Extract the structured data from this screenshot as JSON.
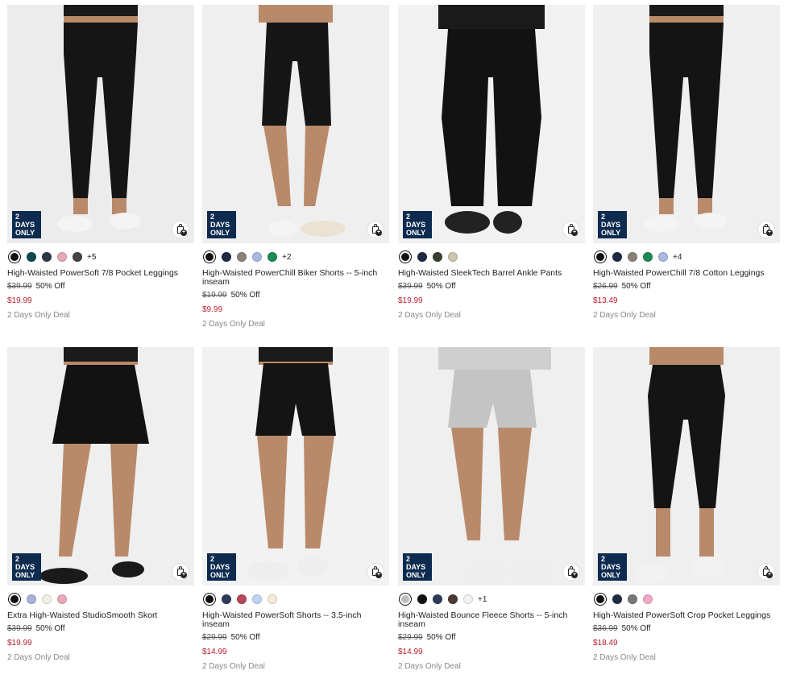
{
  "products": [
    {
      "name": "High-Waisted PowerSoft 7/8 Pocket Leggings",
      "original_price": "$39.99",
      "discount": "50% Off",
      "sale_price": "$19.99",
      "deal": "2 Days Only Deal",
      "badge": "2 DAYS ONLY",
      "swatches": [
        "#111111",
        "#0e4a4e",
        "#2d3748",
        "#e8a9b6",
        "#444444"
      ],
      "more": "+5",
      "garment": "leggings",
      "garment_color": "#151515",
      "bg": "#ececec"
    },
    {
      "name": "High-Waisted PowerChill Biker Shorts -- 5-inch inseam",
      "original_price": "$19.99",
      "discount": "50% Off",
      "sale_price": "$9.99",
      "deal": "2 Days Only Deal",
      "badge": "2 DAYS ONLY",
      "swatches": [
        "#111111",
        "#1f2a44",
        "#8a8279",
        "#a9b8e0",
        "#1c8a55"
      ],
      "more": "+2",
      "garment": "biker",
      "garment_color": "#161616",
      "bg": "#efefef"
    },
    {
      "name": "High-Waisted SleekTech Barrel Ankle Pants",
      "original_price": "$39.99",
      "discount": "50% Off",
      "sale_price": "$19.99",
      "deal": "2 Days Only Deal",
      "badge": "2 DAYS ONLY",
      "swatches": [
        "#111111",
        "#1f2a44",
        "#3a4030",
        "#cfc5ae"
      ],
      "more": "",
      "garment": "barrel",
      "garment_color": "#121212",
      "bg": "#f1f1f1"
    },
    {
      "name": "High-Waisted PowerChill 7/8 Cotton Leggings",
      "original_price": "$26.99",
      "discount": "50% Off",
      "sale_price": "$13.49",
      "deal": "2 Days Only Deal",
      "badge": "2 DAYS ONLY",
      "swatches": [
        "#111111",
        "#1f2a44",
        "#8a8279",
        "#1c8a55",
        "#a9b8e0"
      ],
      "more": "+4",
      "garment": "leggings",
      "garment_color": "#141414",
      "bg": "#efefef"
    },
    {
      "name": "Extra High-Waisted StudioSmooth Skort",
      "original_price": "$39.99",
      "discount": "50% Off",
      "sale_price": "$19.99",
      "deal": "2 Days Only Deal",
      "badge": "2 DAYS ONLY",
      "swatches": [
        "#111111",
        "#a9b3d8",
        "#f4efe4",
        "#e8a9b6"
      ],
      "more": "",
      "garment": "skort",
      "garment_color": "#121212",
      "bg": "#efefef"
    },
    {
      "name": "High-Waisted PowerSoft Shorts -- 3.5-inch inseam",
      "original_price": "$29.99",
      "discount": "50% Off",
      "sale_price": "$14.99",
      "deal": "2 Days Only Deal",
      "badge": "2 DAYS ONLY",
      "swatches": [
        "#111111",
        "#2d3a5a",
        "#b5485a",
        "#bcd4f4",
        "#f4ecd8"
      ],
      "more": "",
      "garment": "shorts",
      "garment_color": "#141414",
      "bg": "#f2f2f2"
    },
    {
      "name": "High-Waisted Bounce Fleece Shorts -- 5-inch inseam",
      "original_price": "$29.99",
      "discount": "50% Off",
      "sale_price": "$14.99",
      "deal": "2 Days Only Deal",
      "badge": "2 DAYS ONLY",
      "swatches": [
        "#bdbdbd",
        "#111111",
        "#2d3a5a",
        "#4a3a32",
        "#f2f2f2"
      ],
      "more": "+1",
      "garment": "fleece",
      "garment_color": "#c4c4c4",
      "bg": "#efefef"
    },
    {
      "name": "High-Waisted PowerSoft Crop Pocket Leggings",
      "original_price": "$36.99",
      "discount": "50% Off",
      "sale_price": "$18.49",
      "deal": "2 Days Only Deal",
      "badge": "2 DAYS ONLY",
      "swatches": [
        "#111111",
        "#1f2a44",
        "#777777",
        "#f0a8c8"
      ],
      "more": "",
      "garment": "crop",
      "garment_color": "#141414",
      "bg": "#efefef"
    }
  ]
}
